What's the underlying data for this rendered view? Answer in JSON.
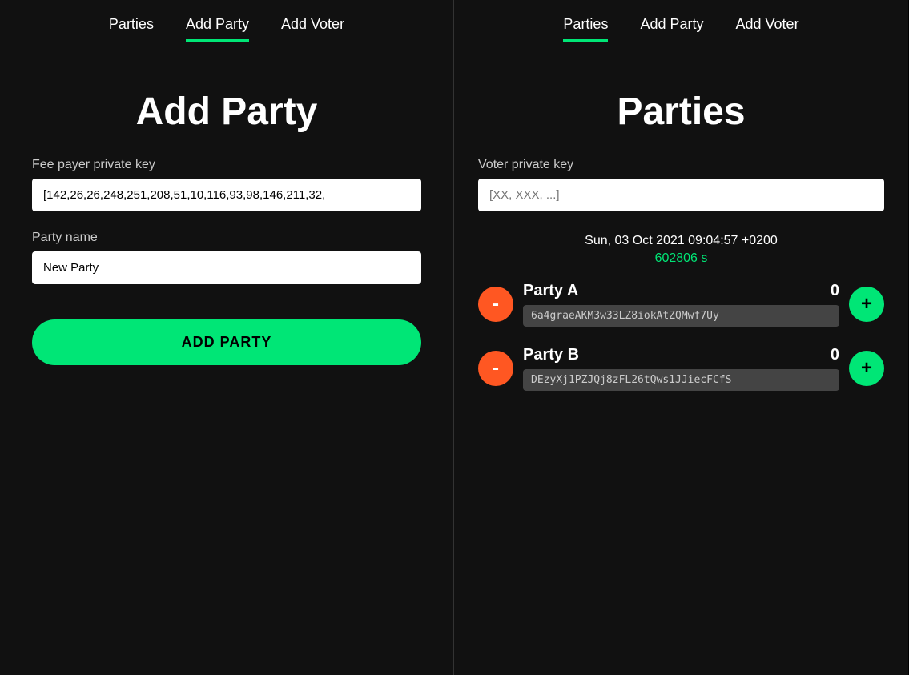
{
  "left_panel": {
    "nav": {
      "items": [
        {
          "label": "Parties",
          "active": false
        },
        {
          "label": "Add Party",
          "active": true
        },
        {
          "label": "Add Voter",
          "active": false
        }
      ]
    },
    "title": "Add Party",
    "fee_payer_label": "Fee payer private key",
    "fee_payer_value": "[142,26,26,248,251,208,51,10,116,93,98,146,211,32,",
    "party_name_label": "Party name",
    "party_name_value": "New Party |",
    "party_name_placeholder": "New Party",
    "add_party_button": "ADD PARTY"
  },
  "right_panel": {
    "nav": {
      "items": [
        {
          "label": "Parties",
          "active": true
        },
        {
          "label": "Add Party",
          "active": false
        },
        {
          "label": "Add Voter",
          "active": false
        }
      ]
    },
    "title": "Parties",
    "voter_key_label": "Voter private key",
    "voter_key_placeholder": "[XX, XXX, ...]",
    "datetime": "Sun, 03 Oct 2021 09:04:57 +0200",
    "timer": "602806 s",
    "parties": [
      {
        "name": "Party A",
        "count": 0,
        "address": "6a4graeAKM3w33LZ8iokAtZQMwf7Uy"
      },
      {
        "name": "Party B",
        "count": 0,
        "address": "DEzyXj1PZJQj8zFL26tQws1JJiecFCfS"
      }
    ]
  }
}
